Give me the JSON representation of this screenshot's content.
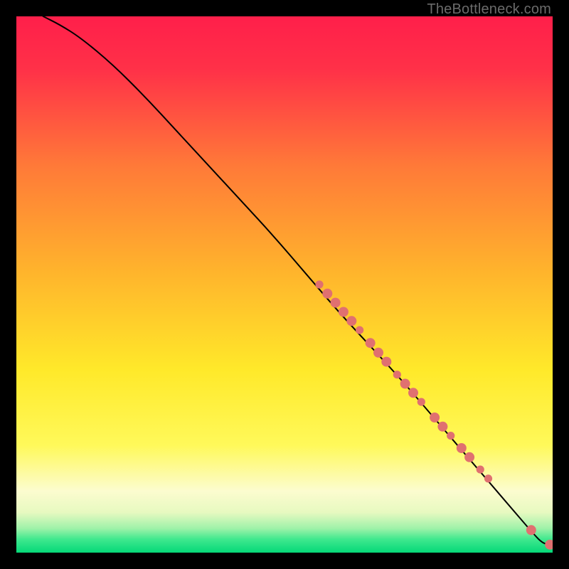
{
  "watermark": "TheBottleneck.com",
  "colors": {
    "gradient_top": "#ff1f4a",
    "gradient_mid_orange": "#ff8a2a",
    "gradient_yellow": "#fff02a",
    "gradient_pale": "#fbfbcc",
    "gradient_green": "#05e27f",
    "line": "#000000",
    "marker": "#e07070"
  },
  "chart_data": {
    "type": "line",
    "title": "",
    "xlabel": "",
    "ylabel": "",
    "xlim": [
      0,
      100
    ],
    "ylim": [
      0,
      100
    ],
    "series": [
      {
        "name": "curve",
        "x": [
          5,
          8,
          12,
          18,
          24,
          30,
          36,
          42,
          48,
          54,
          60,
          66,
          72,
          78,
          84,
          90,
          93,
          96,
          98,
          99.5
        ],
        "y": [
          100,
          98.5,
          96,
          91,
          85,
          78.5,
          72,
          65.5,
          59,
          52,
          45,
          38.5,
          32,
          25,
          18,
          11,
          7.5,
          4,
          1.8,
          1.5
        ]
      }
    ],
    "markers": [
      {
        "x": 56.5,
        "y": 50,
        "r": 4
      },
      {
        "x": 58,
        "y": 48.3,
        "r": 5
      },
      {
        "x": 59.5,
        "y": 46.6,
        "r": 5
      },
      {
        "x": 61,
        "y": 44.9,
        "r": 5
      },
      {
        "x": 62.5,
        "y": 43.2,
        "r": 5
      },
      {
        "x": 64,
        "y": 41.5,
        "r": 4
      },
      {
        "x": 66,
        "y": 39.1,
        "r": 5
      },
      {
        "x": 67.5,
        "y": 37.3,
        "r": 5
      },
      {
        "x": 69,
        "y": 35.6,
        "r": 5
      },
      {
        "x": 71,
        "y": 33.2,
        "r": 4
      },
      {
        "x": 72.5,
        "y": 31.5,
        "r": 5
      },
      {
        "x": 74,
        "y": 29.8,
        "r": 5
      },
      {
        "x": 75.5,
        "y": 28.1,
        "r": 4
      },
      {
        "x": 78,
        "y": 25.2,
        "r": 5
      },
      {
        "x": 79.5,
        "y": 23.5,
        "r": 5
      },
      {
        "x": 81,
        "y": 21.8,
        "r": 4
      },
      {
        "x": 83,
        "y": 19.5,
        "r": 5
      },
      {
        "x": 84.5,
        "y": 17.8,
        "r": 5
      },
      {
        "x": 86.5,
        "y": 15.5,
        "r": 4
      },
      {
        "x": 88,
        "y": 13.8,
        "r": 4
      },
      {
        "x": 96,
        "y": 4.2,
        "r": 5
      },
      {
        "x": 99.5,
        "y": 1.5,
        "r": 5
      },
      {
        "x": 100.1,
        "y": 1.5,
        "r": 4
      }
    ]
  }
}
